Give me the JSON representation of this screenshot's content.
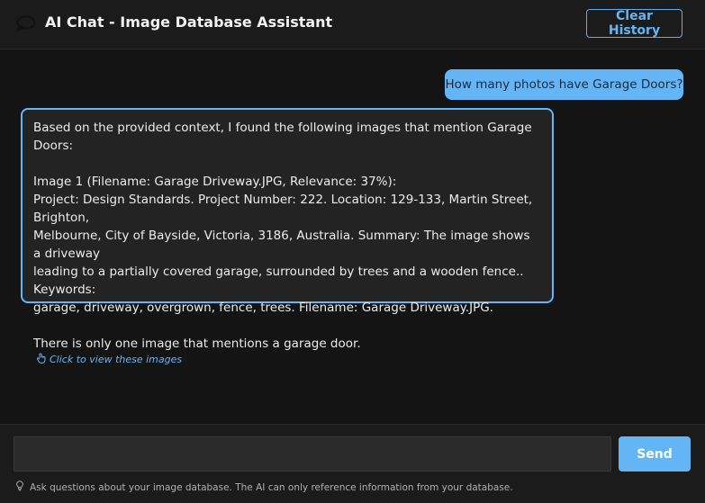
{
  "header": {
    "icon": "chat-bubble-icon",
    "title": "AI Chat - Image Database Assistant",
    "clear_button": "Clear History"
  },
  "messages": {
    "user": "How many photos have Garage Doors?",
    "assistant": "Based on the provided context, I found the following images that mention Garage Doors:\n\nImage 1 (Filename: Garage Driveway.JPG, Relevance: 37%):\nProject: Design Standards. Project Number: 222. Location: 129-133, Martin Street, Brighton,\nMelbourne, City of Bayside, Victoria, 3186, Australia. Summary: The image shows a driveway\nleading to a partially covered garage, surrounded by trees and a wooden fence.. Keywords:\ngarage, driveway, overgrown, fence, trees. Filename: Garage Driveway.JPG.\n\nThere is only one image that mentions a garage door.",
    "view_link": "Click to view these images",
    "view_link_icon": "hand-pointer-icon"
  },
  "input": {
    "value": "",
    "placeholder": "",
    "send_button": "Send",
    "hint_icon": "lightbulb-icon",
    "hint": "Ask questions about your image database. The AI can only reference information from your database."
  },
  "colors": {
    "accent": "#64b5f6",
    "background": "#141414",
    "panel": "#1b1b1b",
    "bubble": "#232323"
  }
}
